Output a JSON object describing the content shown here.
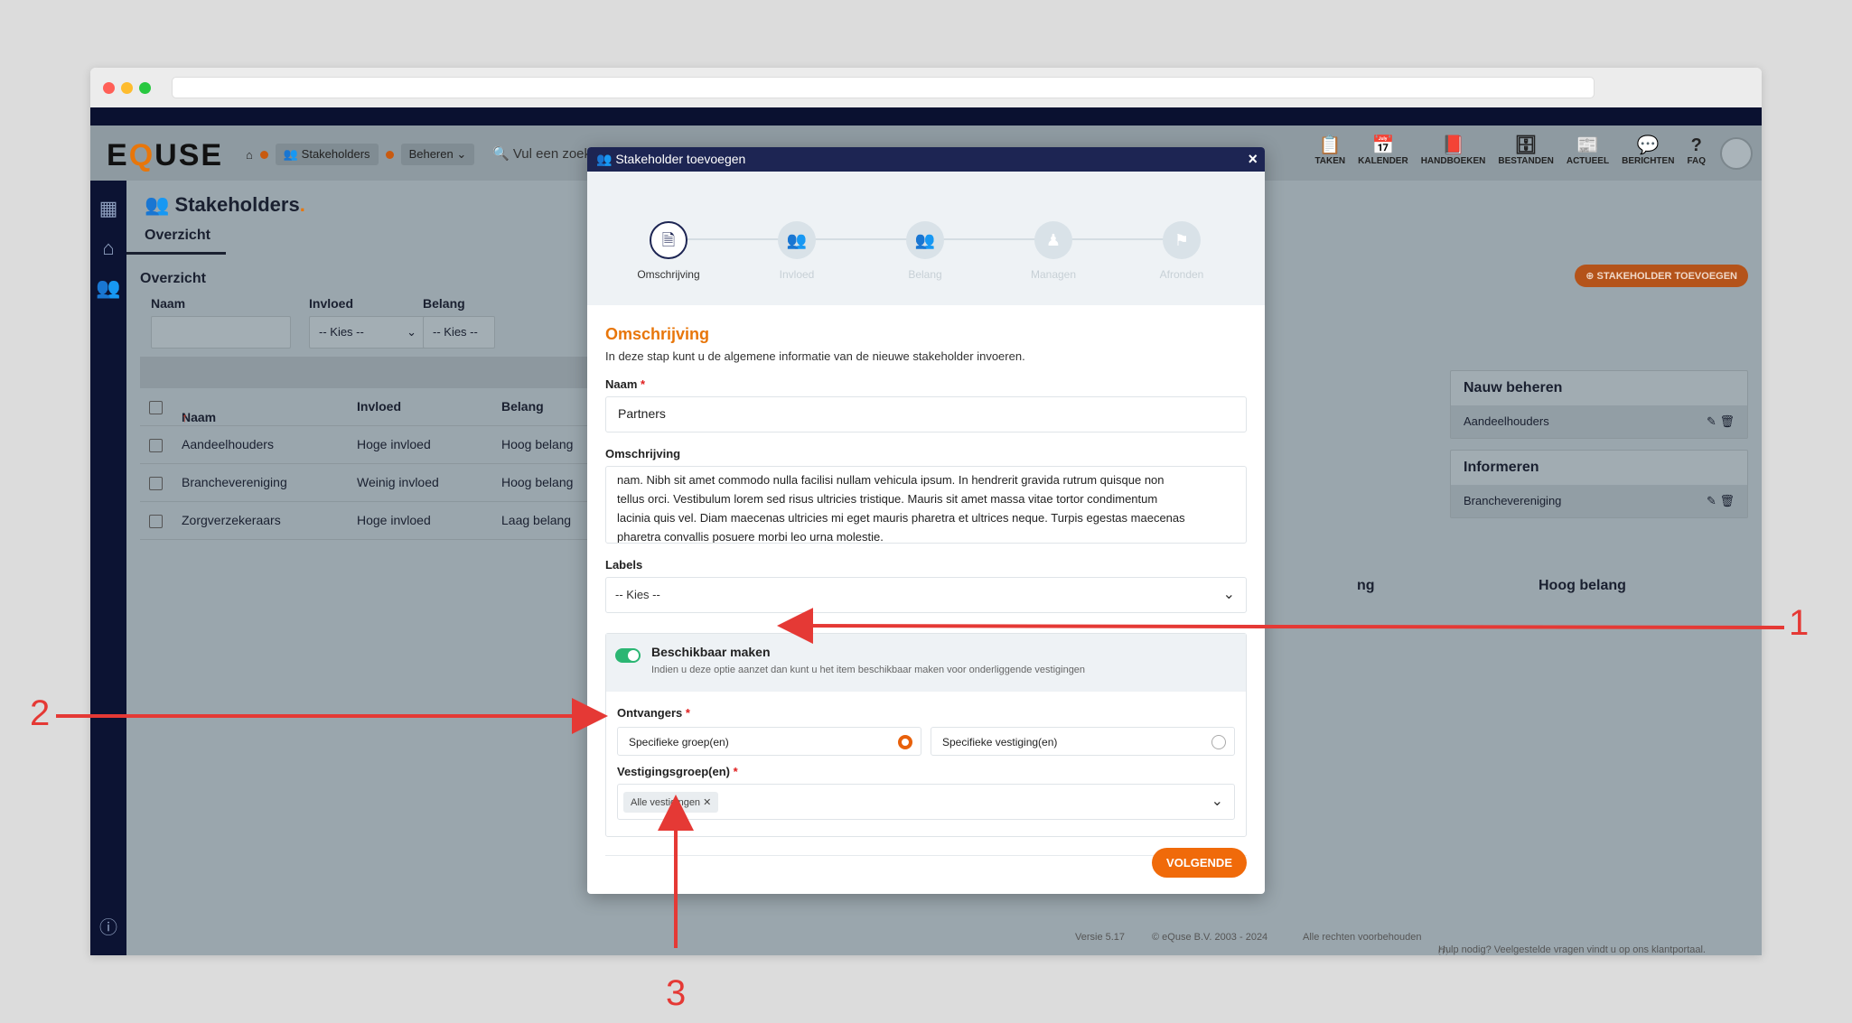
{
  "app": {
    "logo": "EQUSE",
    "breadcrumbs": [
      "Stakeholders",
      "Beheren"
    ],
    "search_placeholder": "Vul een zoek",
    "top_icons": [
      {
        "label": "TAKEN",
        "icon": "clipboard-icon"
      },
      {
        "label": "KALENDER",
        "icon": "calendar-icon"
      },
      {
        "label": "HANDBOEKEN",
        "icon": "book-icon"
      },
      {
        "label": "BESTANDEN",
        "icon": "archive-icon"
      },
      {
        "label": "ACTUEEL",
        "icon": "news-icon"
      },
      {
        "label": "BERICHTEN",
        "icon": "chat-icon"
      },
      {
        "label": "FAQ",
        "icon": "question-icon"
      }
    ]
  },
  "page": {
    "title": "Stakeholders",
    "tab": "Overzicht",
    "section_title": "Overzicht",
    "add_button": "STAKEHOLDER TOEVOEGEN",
    "filters": {
      "naam_label": "Naam",
      "invloed_label": "Invloed",
      "invloed_value": "-- Kies --",
      "belang_label": "Belang",
      "belang_value": "-- Kies --"
    },
    "table": {
      "headers": [
        "Naam",
        "Invloed",
        "Belang"
      ],
      "rows": [
        [
          "Aandeelhouders",
          "Hoge invloed",
          "Hoog belang"
        ],
        [
          "Branchevereniging",
          "Weinig invloed",
          "Hoog belang"
        ],
        [
          "Zorgverzekeraars",
          "Hoge invloed",
          "Laag belang"
        ]
      ]
    },
    "cards": [
      {
        "title": "Nauw beheren",
        "item": "Aandeelhouders"
      },
      {
        "title": "Informeren",
        "item": "Branchevereniging"
      }
    ],
    "partial_col_label": "ng",
    "col_label": "Hoog belang",
    "footer": {
      "version": "Versie 5.17",
      "copyright": "© eQuse B.V. 2003 - 2024",
      "rights": "Alle rechten voorbehouden",
      "help": "Hulp nodig? Veelgestelde vragen vindt u op ons klantportaal."
    }
  },
  "modal": {
    "title": "Stakeholder toevoegen",
    "steps": [
      "Omschrijving",
      "Invloed",
      "Belang",
      "Managen",
      "Afronden"
    ],
    "section_title": "Omschrijving",
    "section_desc": "In deze stap kunt u de algemene informatie van de nieuwe stakeholder invoeren.",
    "naam_label": "Naam",
    "naam_value": "Partners",
    "omschrijving_label": "Omschrijving",
    "omschrijving_lines": [
      "nam. Nibh sit amet commodo nulla facilisi nullam vehicula ipsum. In hendrerit gravida rutrum quisque non",
      "tellus orci. Vestibulum lorem sed risus ultricies tristique. Mauris sit amet massa vitae tortor condimentum",
      "lacinia quis vel. Diam maecenas ultricies mi eget mauris pharetra et ultrices neque. Turpis egestas maecenas",
      "pharetra convallis posuere morbi leo urna molestie."
    ],
    "labels_label": "Labels",
    "labels_value": "-- Kies --",
    "available_title": "Beschikbaar maken",
    "available_desc": "Indien u deze optie aanzet dan kunt u het item beschikbaar maken voor onderliggende vestigingen",
    "ontvangers_label": "Ontvangers",
    "radio_group": "Specifieke groep(en)",
    "radio_location": "Specifieke vestiging(en)",
    "vestigingsgroep_label": "Vestigingsgroep(en)",
    "vestigingsgroep_tag": "Alle vestigingen",
    "next_button": "VOLGENDE"
  },
  "annotations": {
    "one": "1",
    "two": "2",
    "three": "3"
  },
  "colors": {
    "accent": "#e8760a",
    "header": "#1d2553",
    "annotation": "#e53935",
    "toggle_on": "#2bb673"
  }
}
